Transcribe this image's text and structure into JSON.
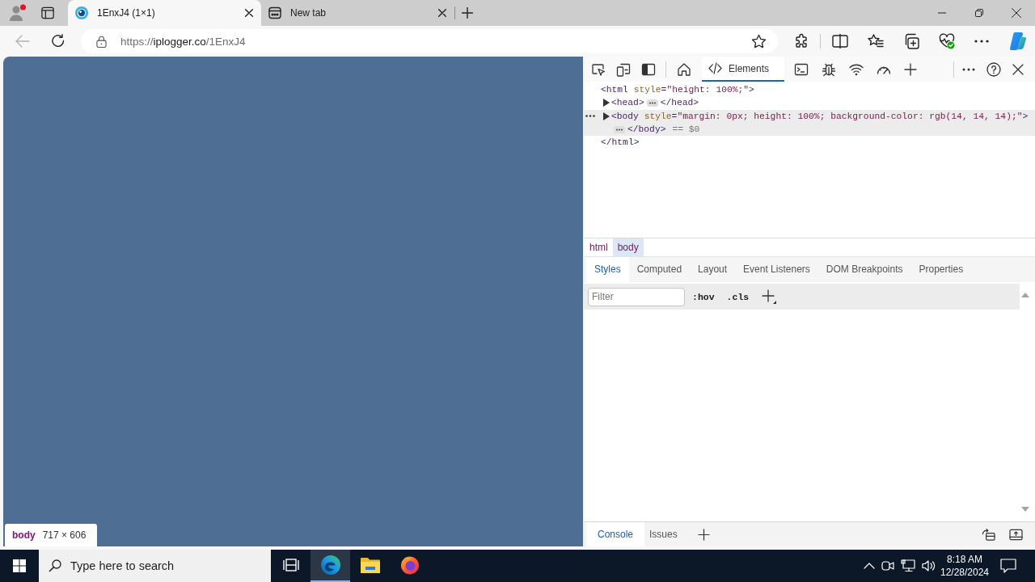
{
  "browser": {
    "tabs": [
      {
        "title": "1EnxJ4 (1×1)",
        "kind": "page",
        "selected": true
      },
      {
        "title": "New tab",
        "kind": "new_tab",
        "selected": false
      }
    ],
    "back_button": {
      "disabled": true
    },
    "address_bar": {
      "scheme": "https://",
      "host": "iplogger.co",
      "path": "/1EnxJ4"
    }
  },
  "page": {
    "inspect_tooltip": {
      "tag": "body",
      "size": "717 × 606"
    }
  },
  "devtools": {
    "panel_tabs": [
      {
        "label": "Elements",
        "selected": true
      }
    ],
    "dom_tree": [
      {
        "open_tag": "<html style=\"height: 100%;\">",
        "close_tag": "</html>",
        "expanded": true,
        "selected": false,
        "children": [
          {
            "open_tag": "<head>",
            "close_tag": "</head>",
            "expanded": false,
            "selected": false
          },
          {
            "open_tag": "<body style=\"margin: 0px; height: 100%; background-color: rgb(14, 14, 14);\">",
            "close_tag": "</body>",
            "expanded": false,
            "selected": true,
            "reference": "== $0"
          }
        ]
      }
    ],
    "breadcrumbs": [
      {
        "label": "html",
        "selected": false
      },
      {
        "label": "body",
        "selected": true
      }
    ],
    "style_tabs": [
      {
        "label": "Styles",
        "selected": true
      },
      {
        "label": "Computed",
        "selected": false
      },
      {
        "label": "Layout",
        "selected": false
      },
      {
        "label": "Event Listeners",
        "selected": false
      },
      {
        "label": "DOM Breakpoints",
        "selected": false
      },
      {
        "label": "Properties",
        "selected": false
      }
    ],
    "filter": {
      "placeholder": "Filter"
    },
    "style_buttons": [
      ":hov",
      ".cls"
    ],
    "drawer_tabs": [
      {
        "label": "Console",
        "selected": true
      },
      {
        "label": "Issues",
        "selected": false
      }
    ]
  },
  "taskbar": {
    "search": {
      "placeholder": "Type here to search"
    },
    "apps": [
      {
        "kind": "task_view",
        "active": false
      },
      {
        "kind": "edge",
        "active": true
      },
      {
        "kind": "explorer",
        "active": false
      },
      {
        "kind": "firefox",
        "active": false
      }
    ],
    "time": "8:18 AM",
    "date": "12/28/2024"
  }
}
